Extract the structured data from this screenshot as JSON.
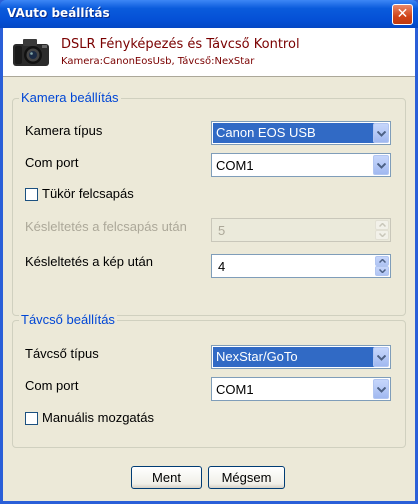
{
  "window": {
    "title": "VAuto beállítás",
    "close_symbol": "✕"
  },
  "header": {
    "title": "DSLR Fényképezés és Távcső Kontrol",
    "subtitle": "Kamera:CanonEosUsb, Távcső:NexStar",
    "icon": "camera-icon"
  },
  "camera_group": {
    "legend": "Kamera beállítás",
    "type_label": "Kamera típus",
    "type_value": "Canon EOS USB",
    "port_label": "Com port",
    "port_value": "COM1",
    "mirror_label": "Tükör felcsapás",
    "mirror_checked": false,
    "delay_mirror_label": "Késleltetés a felcsapás után",
    "delay_mirror_value": "5",
    "delay_image_label": "Késleltetés a kép után",
    "delay_image_value": "4"
  },
  "scope_group": {
    "legend": "Távcső beállítás",
    "type_label": "Távcső típus",
    "type_value": "NexStar/GoTo",
    "port_label": "Com port",
    "port_value": "COM1",
    "manual_label": "Manuális mozgatás",
    "manual_checked": false
  },
  "buttons": {
    "ok": "Ment",
    "cancel": "Mégsem"
  },
  "colors": {
    "title_bar": "#0550d6",
    "header_text": "#7a0000",
    "group_legend": "#0046d5",
    "selection": "#316ac5"
  }
}
